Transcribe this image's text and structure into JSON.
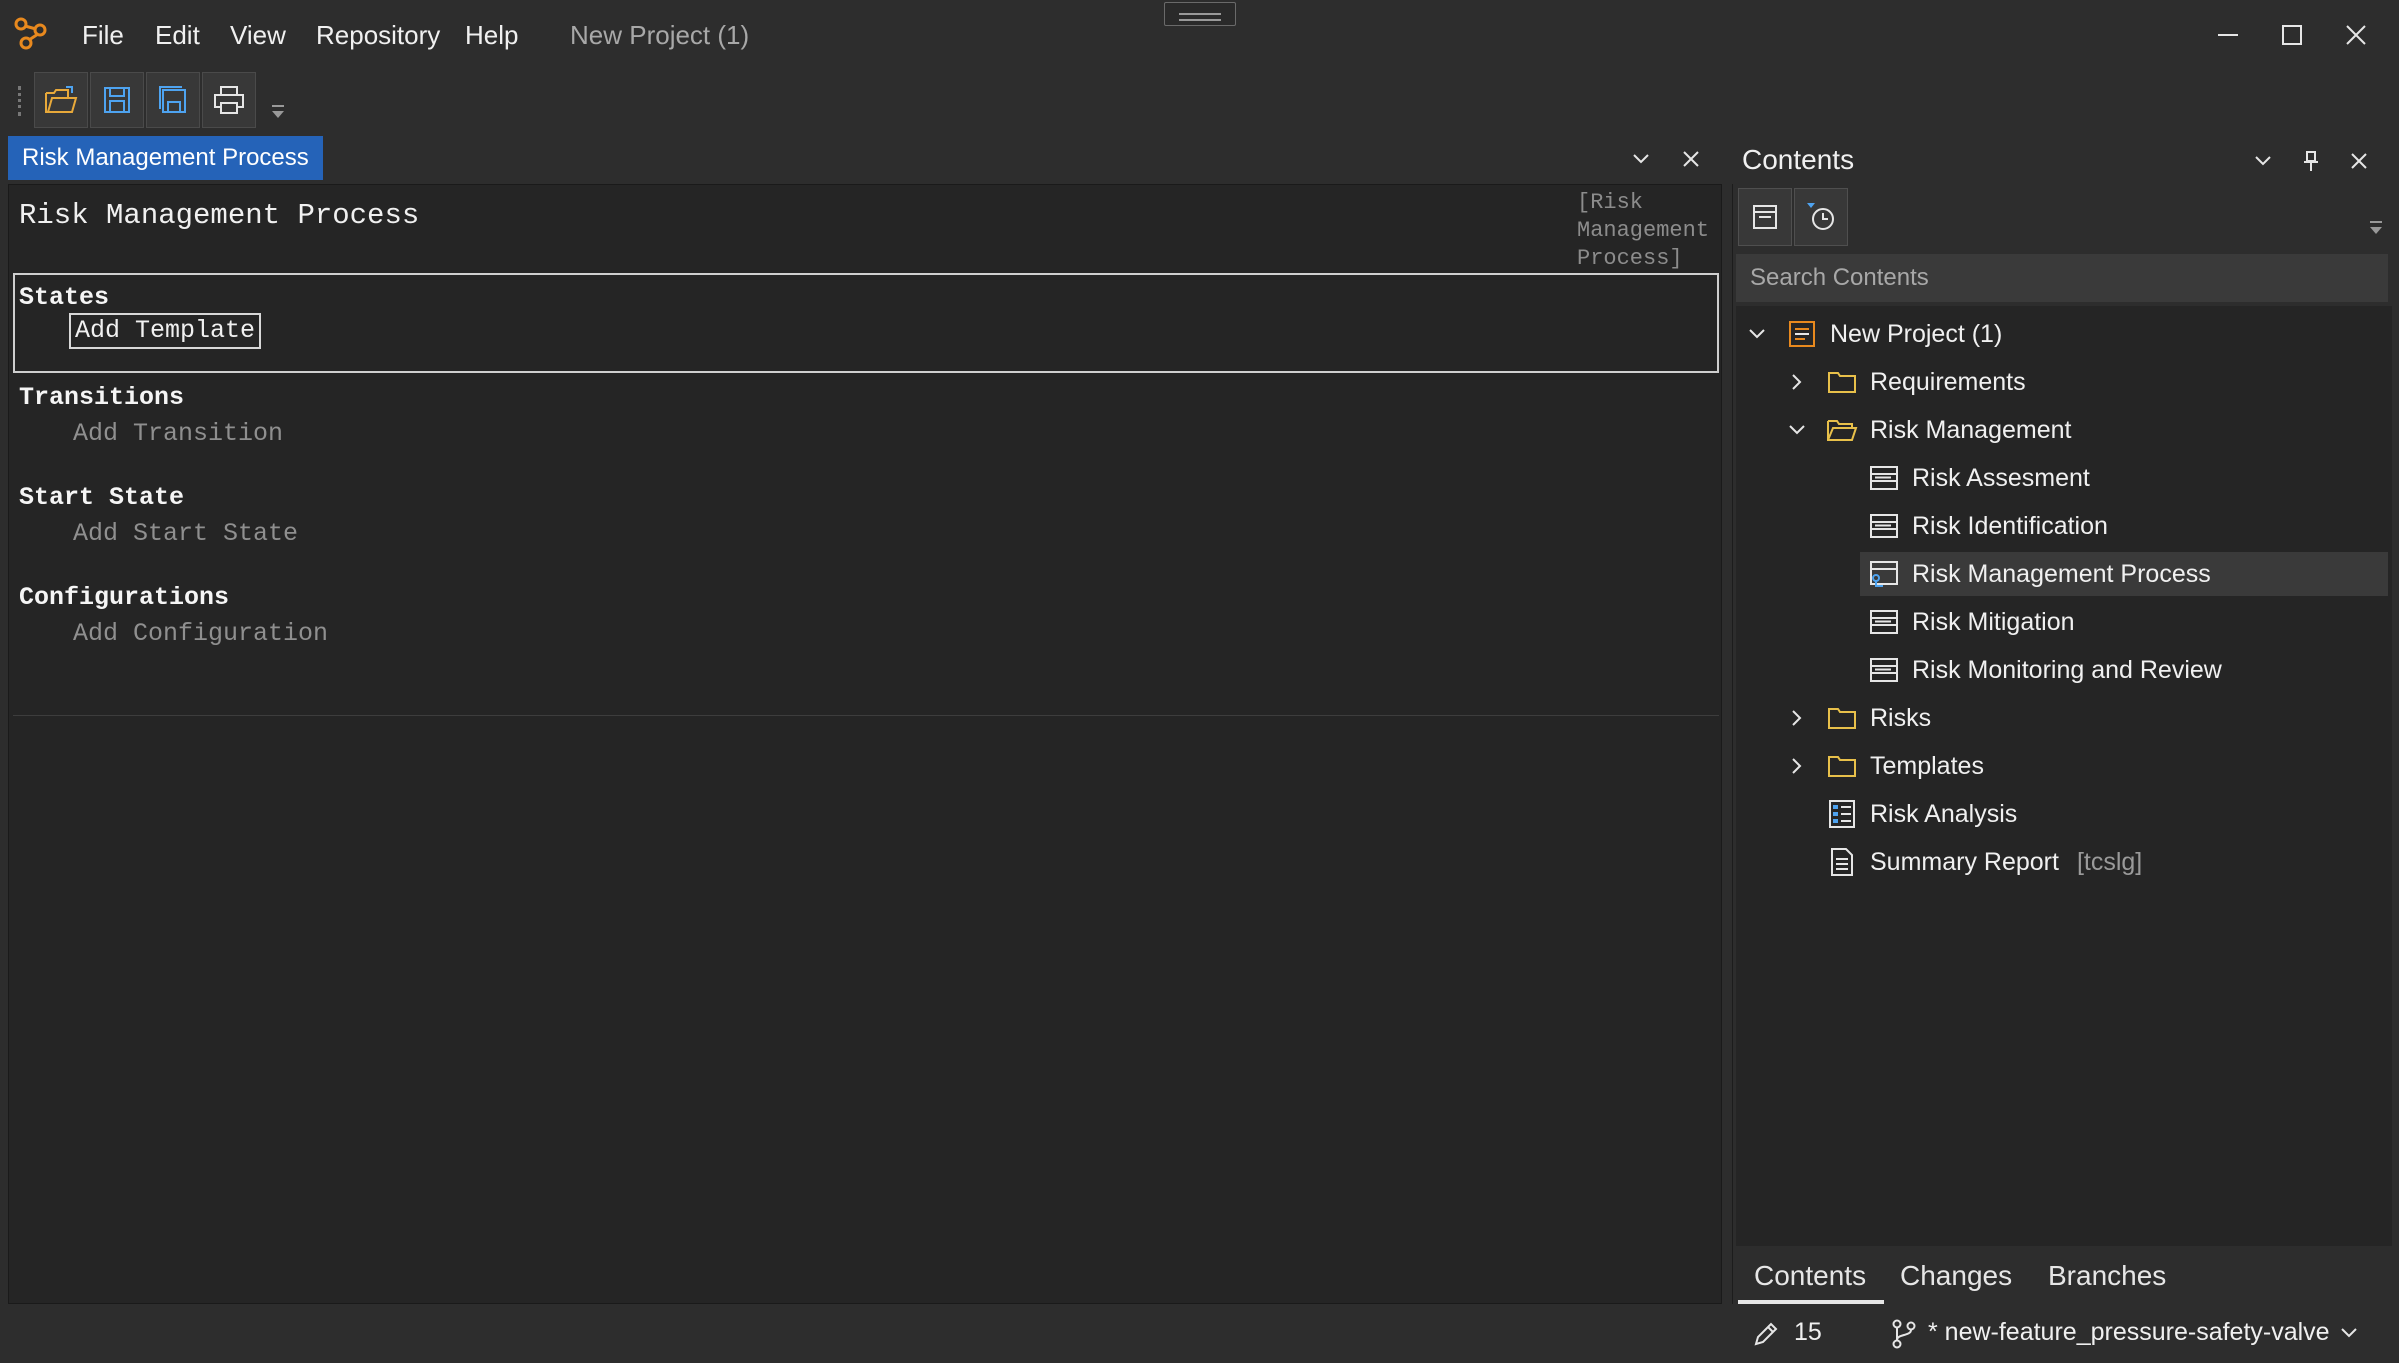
{
  "menu": {
    "items": [
      "File",
      "Edit",
      "View",
      "Repository",
      "Help"
    ],
    "project_title": "New Project (1)"
  },
  "toolbar": {
    "buttons": [
      "open-folder-icon",
      "save-icon",
      "save-all-icon",
      "print-icon"
    ]
  },
  "editor": {
    "tab_label": "Risk Management Process",
    "doc_title": "Risk Management Process",
    "doc_path": "[Risk Management Process]",
    "sections": {
      "states": {
        "heading": "States",
        "add": "Add Template"
      },
      "transitions": {
        "heading": "Transitions",
        "add": "Add Transition"
      },
      "start_state": {
        "heading": "Start State",
        "add": "Add Start State"
      },
      "configurations": {
        "heading": "Configurations",
        "add": "Add Configuration"
      }
    }
  },
  "contents": {
    "title": "Contents",
    "search_placeholder": "Search Contents",
    "tree": {
      "root": "New Project (1)",
      "requirements": "Requirements",
      "risk_management": "Risk Management",
      "risk_assesment": "Risk Assesment",
      "risk_identification": "Risk Identification",
      "risk_management_process": "Risk Management Process",
      "risk_mitigation": "Risk Mitigation",
      "risk_monitoring": "Risk Monitoring and Review",
      "risks": "Risks",
      "templates": "Templates",
      "risk_analysis": "Risk Analysis",
      "summary_report": "Summary Report",
      "summary_report_tag": "[tcslg]"
    },
    "bottom_tabs": [
      "Contents",
      "Changes",
      "Branches"
    ],
    "active_tab": "Contents"
  },
  "status": {
    "edit_count": "15",
    "branch": "* new-feature_pressure-safety-valve"
  },
  "colors": {
    "accent": "#2563b8",
    "background": "#2d2d2d",
    "panel": "#252525",
    "logo": "#e8891e"
  }
}
